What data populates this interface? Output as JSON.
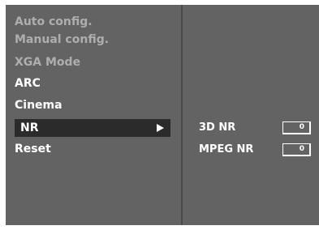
{
  "menu": {
    "items": [
      {
        "label": "Auto config.",
        "state": "disabled"
      },
      {
        "label": "Manual config.",
        "state": "disabled"
      },
      {
        "label": "XGA Mode",
        "state": "disabled"
      },
      {
        "label": "ARC",
        "state": "enabled"
      },
      {
        "label": "Cinema",
        "state": "enabled"
      },
      {
        "label": "NR",
        "state": "selected"
      },
      {
        "label": "Reset",
        "state": "enabled"
      }
    ]
  },
  "submenu": {
    "items": [
      {
        "label": "3D NR",
        "value": "0"
      },
      {
        "label": "MPEG NR",
        "value": "0"
      }
    ]
  },
  "colors": {
    "panel": "#636363",
    "selected_bg": "#2b2b2b",
    "text": "#ffffff",
    "disabled_text": "#aeaeae"
  }
}
